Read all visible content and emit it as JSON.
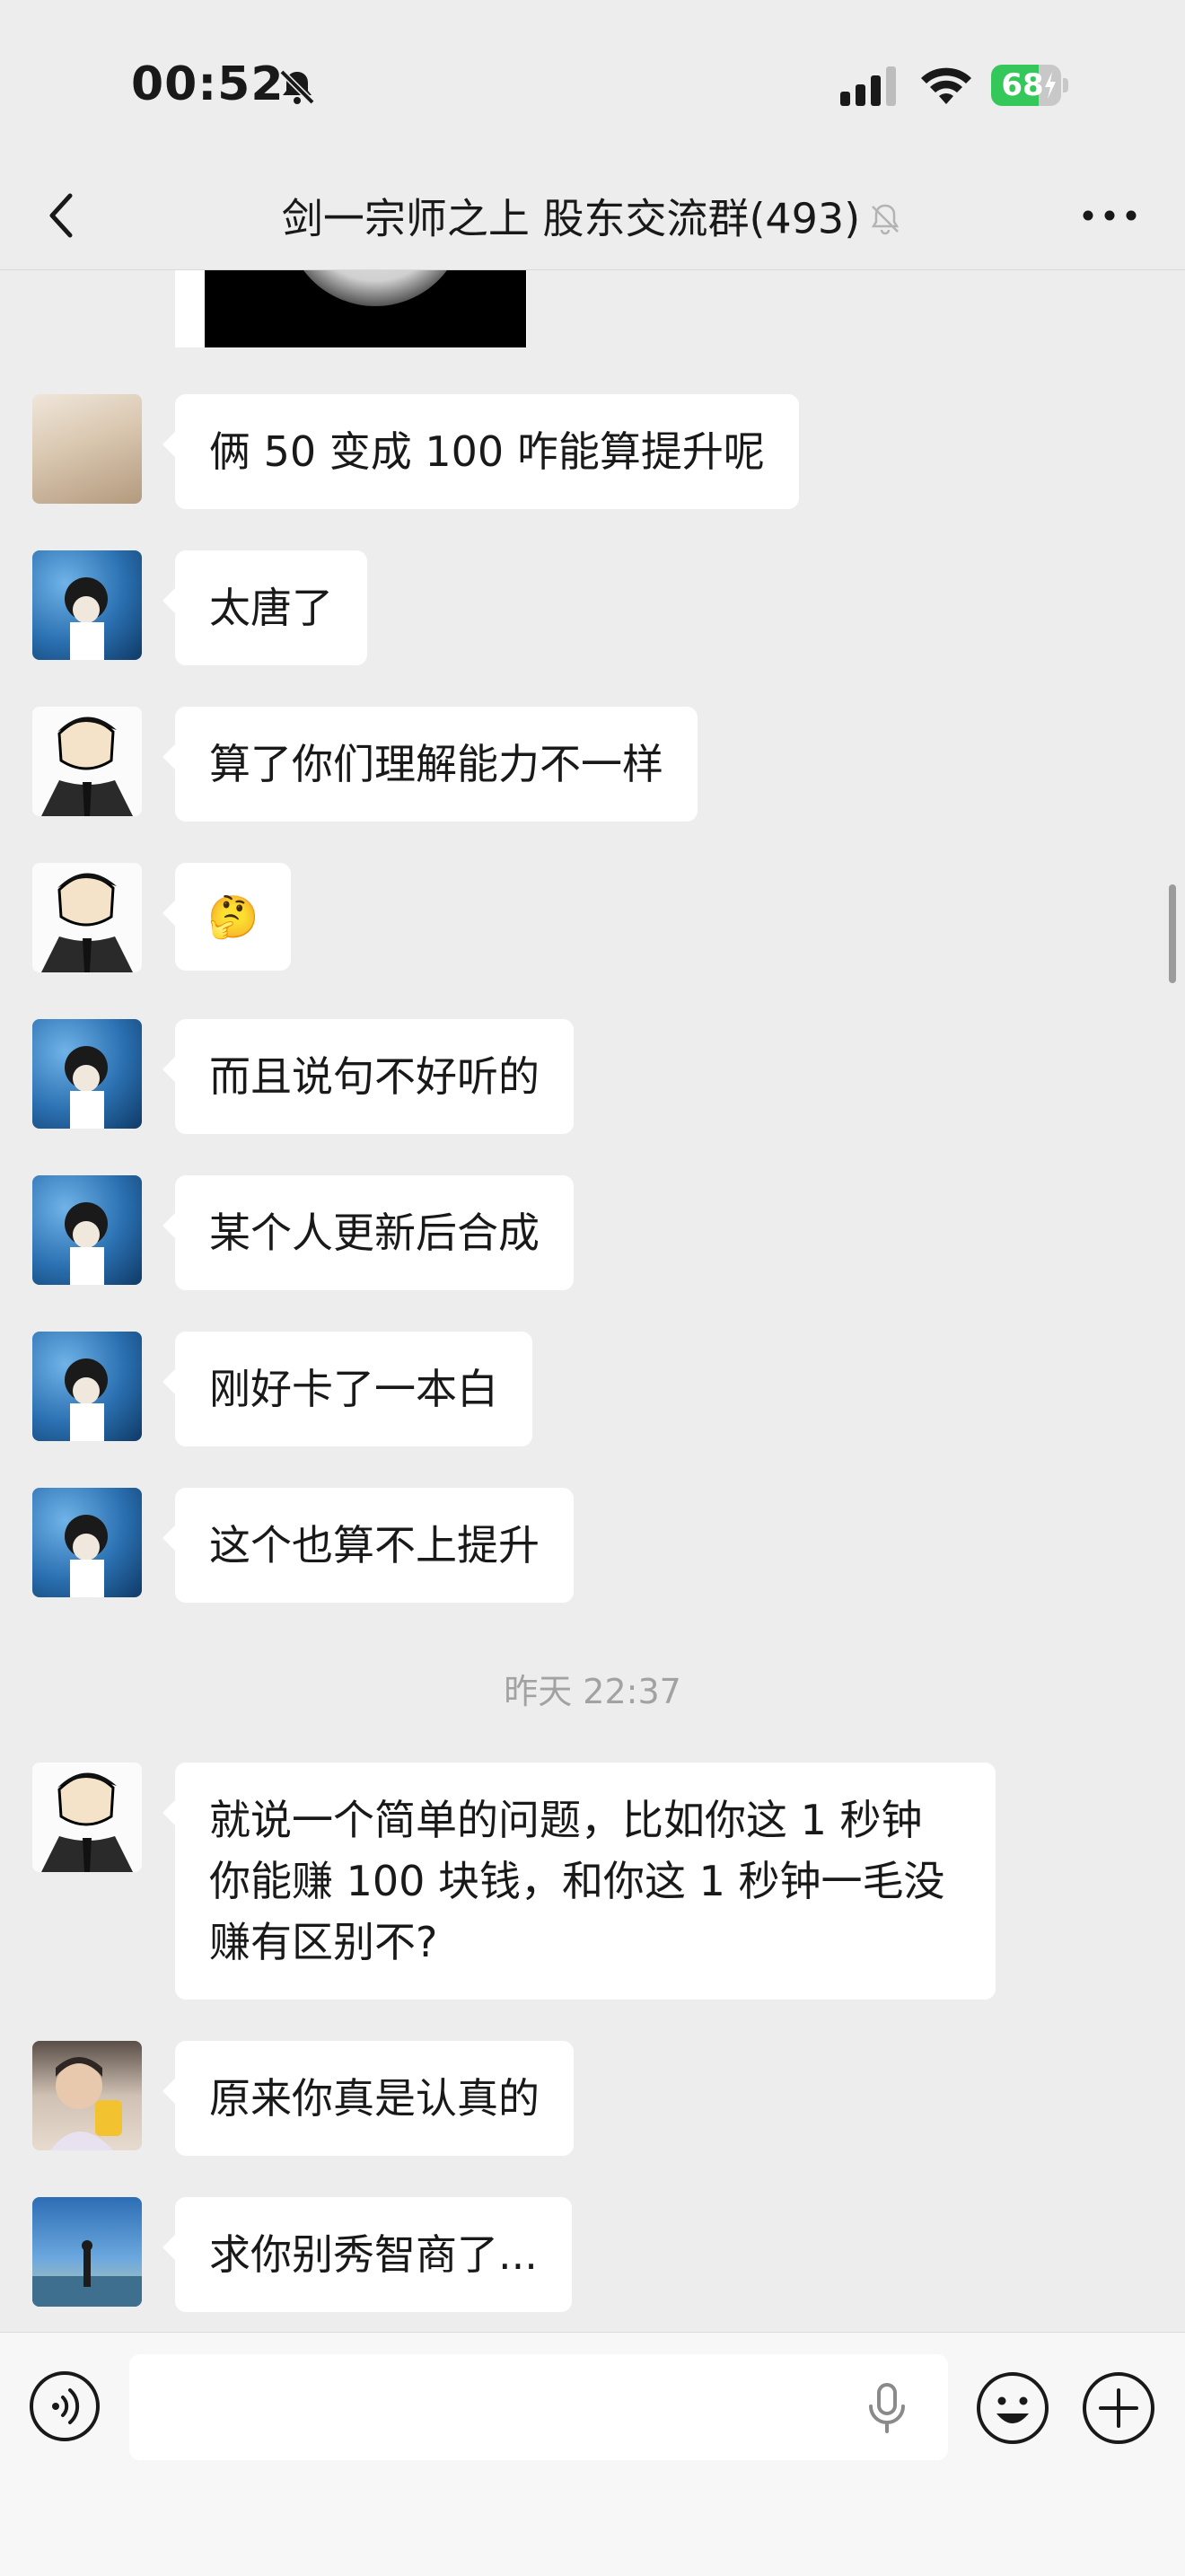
{
  "status_bar": {
    "time": "00:52",
    "battery_level": "68",
    "battery_fraction": 0.68
  },
  "nav": {
    "title": "剑一宗师之上 股东交流群(493)"
  },
  "chat": {
    "messages": [
      {
        "avatar": "cat-photo-avatar",
        "text": "俩 50 变成 100 咋能算提升呢"
      },
      {
        "avatar": "aquarium-avatar",
        "text": "太唐了"
      },
      {
        "avatar": "cartoon-suit-avatar",
        "text": "算了你们理解能力不一样"
      },
      {
        "avatar": "cartoon-suit-avatar",
        "text": "🤔"
      },
      {
        "avatar": "aquarium-avatar",
        "text": "而且说句不好听的"
      },
      {
        "avatar": "aquarium-avatar",
        "text": "某个人更新后合成"
      },
      {
        "avatar": "aquarium-avatar",
        "text": "刚好卡了一本白"
      },
      {
        "avatar": "aquarium-avatar",
        "text": "这个也算不上提升"
      },
      {
        "avatar": "cartoon-suit-avatar",
        "text": "就说一个简单的问题，比如你这 1 秒钟你能赚 100 块钱，和你这 1 秒钟一毛没赚有区别不?"
      },
      {
        "avatar": "child-photo-avatar",
        "text": "原来你真是认真的"
      },
      {
        "avatar": "seaside-avatar",
        "text": "求你别秀智商了..."
      }
    ],
    "timestamp": "昨天 22:37"
  },
  "input": {
    "placeholder": ""
  },
  "colors": {
    "background": "#ededed",
    "bubble": "#ffffff",
    "battery_green": "#34c759",
    "timestamp_gray": "#a2a2a2"
  },
  "icons": [
    "bell-off-icon",
    "cell-signal-icon",
    "wifi-icon",
    "battery-icon",
    "back-chevron-icon",
    "mute-bell-icon",
    "more-dots-icon",
    "voice-icon",
    "microphone-icon",
    "emoji-icon",
    "plus-icon"
  ]
}
